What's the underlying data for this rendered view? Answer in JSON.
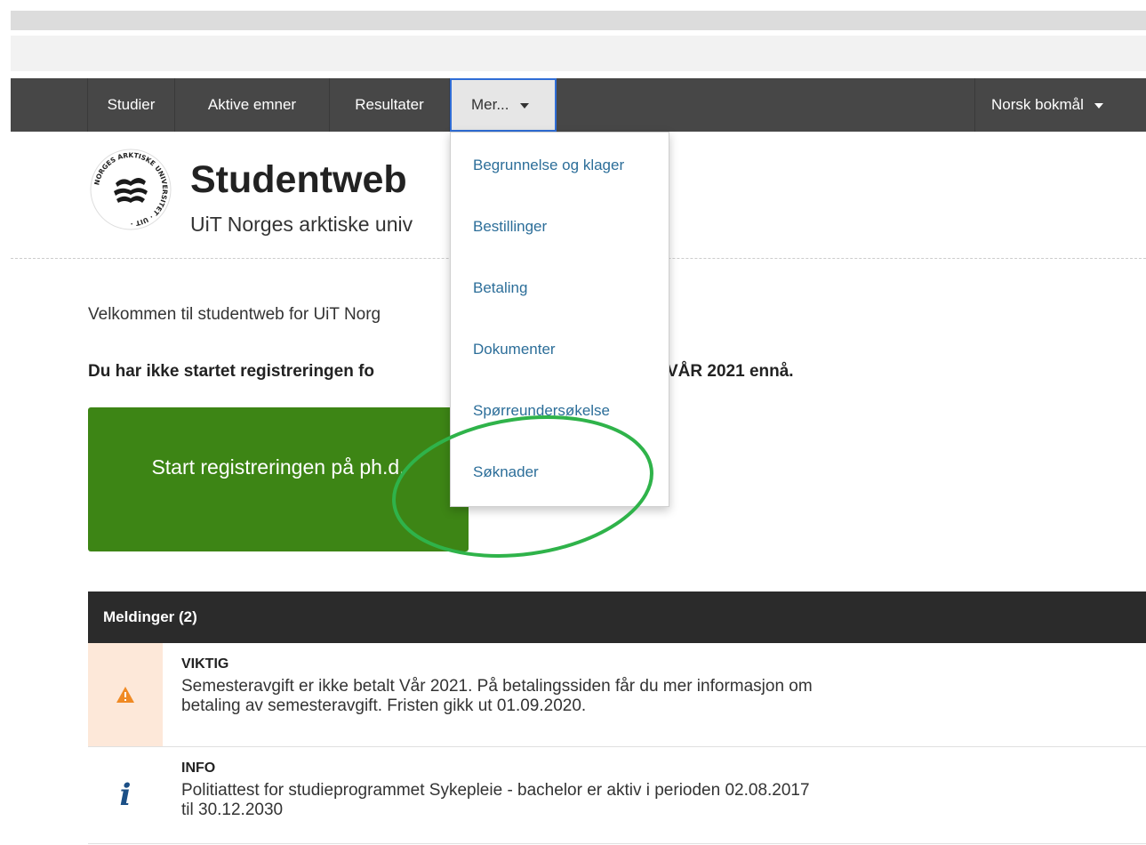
{
  "nav": {
    "items": [
      "Studier",
      "Aktive emner",
      "Resultater"
    ],
    "more_label": "Mer...",
    "language_label": "Norsk bokmål"
  },
  "header": {
    "title": "Studentweb",
    "subtitle": "UiT Norges arktiske univ",
    "logo_text": "NORGES ARKTISKE UNIVERSITET · UIT ·"
  },
  "main": {
    "welcome": "Velkommen til studentweb for UiT Norg",
    "notice_start": "Du har ikke startet registreringen fo",
    "notice_end": "VÅR 2021 ennå.",
    "register_button": "Start registreringen på ph.d."
  },
  "dropdown": {
    "items": [
      "Begrunnelse og klager",
      "Bestillinger",
      "Betaling",
      "Dokumenter",
      "Spørreundersøkelse",
      "Søknader"
    ],
    "highlighted": "Søknader",
    "highlight_color": "#2fb34a"
  },
  "messages": {
    "header": "Meldinger (2)",
    "items": [
      {
        "type": "warning",
        "label": "VIKTIG",
        "text_line1": "Semesteravgift er ikke betalt Vår 2021. På betalingssiden får du mer informasjon om",
        "text_line2": "betaling av semesteravgift. Fristen gikk ut 01.09.2020.",
        "icon": "warning-icon",
        "icon_color": "#f08a24"
      },
      {
        "type": "info",
        "label": "INFO",
        "text_line1": "Politiattest for studieprogrammet Sykepleie - bachelor er aktiv i perioden 02.08.2017",
        "text_line2": "til 30.12.2030",
        "icon": "info-icon",
        "icon_glyph": "i"
      }
    ]
  },
  "colors": {
    "navbar": "#474747",
    "button": "#3d8515",
    "link": "#2c6e99",
    "messages_header": "#2b2b2b"
  }
}
